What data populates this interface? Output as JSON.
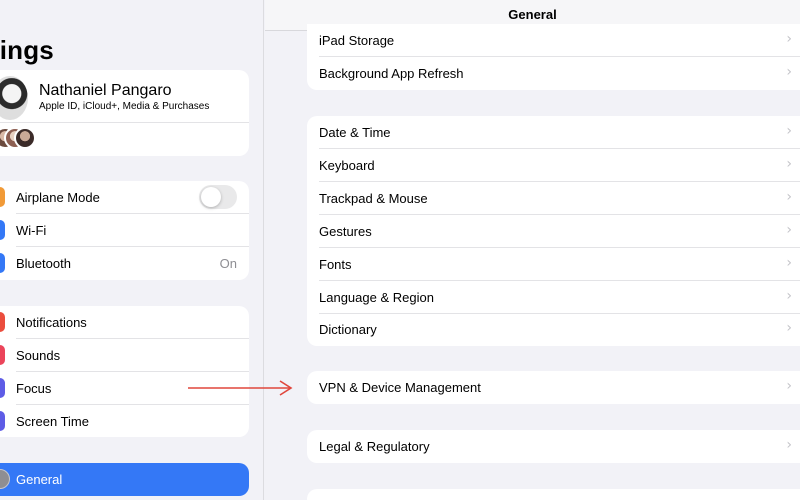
{
  "sidebar": {
    "title": "ttings",
    "profile": {
      "name": "Nathaniel Pangaro",
      "subtitle": "Apple ID, iCloud+, Media & Purchases"
    },
    "connectivity": [
      {
        "label": "Airplane Mode",
        "icon": "airplane-icon",
        "color": "#f19a37",
        "toggle": false
      },
      {
        "label": "Wi-Fi",
        "icon": "wifi-icon",
        "color": "#3478f6"
      },
      {
        "label": "Bluetooth",
        "icon": "bluetooth-icon",
        "color": "#3478f6",
        "value": "On"
      }
    ],
    "notifications": [
      {
        "label": "Notifications",
        "icon": "notifications-icon",
        "color": "#eb4d3d"
      },
      {
        "label": "Sounds",
        "icon": "sounds-icon",
        "color": "#eb445a"
      },
      {
        "label": "Focus",
        "icon": "focus-icon",
        "color": "#5e5ce6"
      },
      {
        "label": "Screen Time",
        "icon": "screen-time-icon",
        "color": "#5e5ce6"
      }
    ],
    "general": {
      "label": "General",
      "icon": "gear-icon",
      "selected": true
    }
  },
  "main": {
    "title": "General",
    "group1": [
      "iPad Storage",
      "Background App Refresh"
    ],
    "group2": [
      "Date & Time",
      "Keyboard",
      "Trackpad & Mouse",
      "Gestures",
      "Fonts",
      "Language & Region",
      "Dictionary"
    ],
    "group3": [
      "VPN & Device Management"
    ],
    "group4": [
      "Legal & Regulatory"
    ]
  },
  "annotation": {
    "color": "#e0463c"
  },
  "colors": {
    "accent": "#3478f6",
    "background": "#f2f2f7"
  }
}
